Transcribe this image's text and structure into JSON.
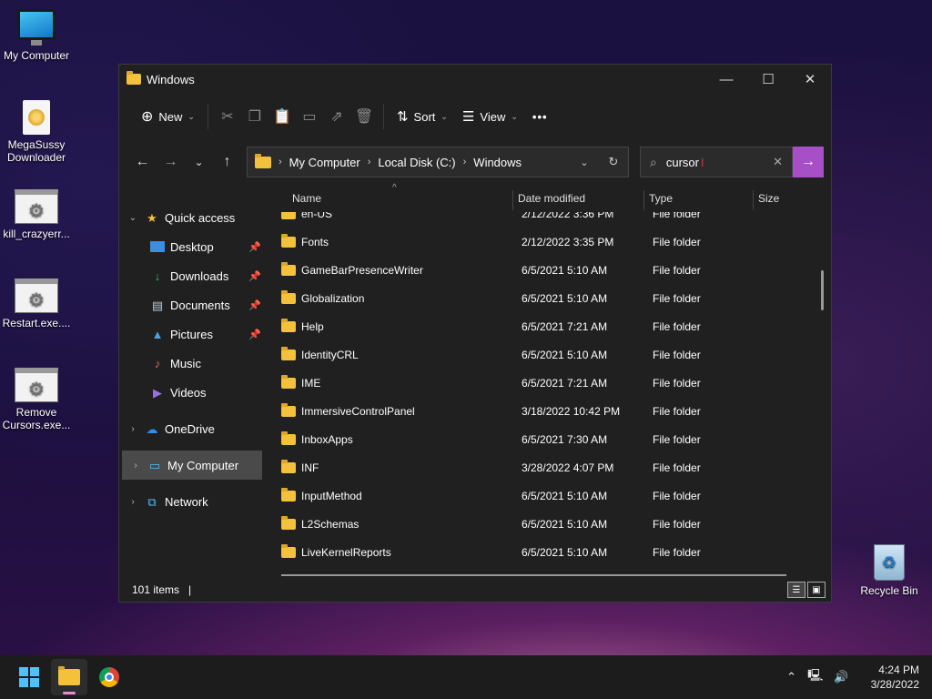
{
  "desktop": {
    "icons": [
      {
        "label": "My Computer"
      },
      {
        "label": "MegaSussy\nDownloader"
      },
      {
        "label": "kill_crazyerr..."
      },
      {
        "label": "Restart.exe...."
      },
      {
        "label": "Remove\nCursors.exe..."
      }
    ],
    "recycle_bin": "Recycle Bin"
  },
  "window": {
    "title": "Windows",
    "toolbar": {
      "new_label": "New",
      "sort_label": "Sort",
      "view_label": "View",
      "more_label": "•••"
    },
    "address": {
      "crumbs": [
        "My Computer",
        "Local Disk (C:)",
        "Windows"
      ]
    },
    "search": {
      "value": "cursor"
    },
    "sidebar": {
      "quick_access": "Quick access",
      "items": [
        "Desktop",
        "Downloads",
        "Documents",
        "Pictures",
        "Music",
        "Videos"
      ],
      "onedrive": "OneDrive",
      "my_computer": "My Computer",
      "network": "Network"
    },
    "columns": {
      "name": "Name",
      "date": "Date modified",
      "type": "Type",
      "size": "Size"
    },
    "rows": [
      {
        "name": "en-US",
        "date": "2/12/2022 3:36 PM",
        "type": "File folder"
      },
      {
        "name": "Fonts",
        "date": "2/12/2022 3:35 PM",
        "type": "File folder"
      },
      {
        "name": "GameBarPresenceWriter",
        "date": "6/5/2021 5:10 AM",
        "type": "File folder"
      },
      {
        "name": "Globalization",
        "date": "6/5/2021 5:10 AM",
        "type": "File folder"
      },
      {
        "name": "Help",
        "date": "6/5/2021 7:21 AM",
        "type": "File folder"
      },
      {
        "name": "IdentityCRL",
        "date": "6/5/2021 5:10 AM",
        "type": "File folder"
      },
      {
        "name": "IME",
        "date": "6/5/2021 7:21 AM",
        "type": "File folder"
      },
      {
        "name": "ImmersiveControlPanel",
        "date": "3/18/2022 10:42 PM",
        "type": "File folder"
      },
      {
        "name": "InboxApps",
        "date": "6/5/2021 7:30 AM",
        "type": "File folder"
      },
      {
        "name": "INF",
        "date": "3/28/2022 4:07 PM",
        "type": "File folder"
      },
      {
        "name": "InputMethod",
        "date": "6/5/2021 5:10 AM",
        "type": "File folder"
      },
      {
        "name": "L2Schemas",
        "date": "6/5/2021 5:10 AM",
        "type": "File folder"
      },
      {
        "name": "LiveKernelReports",
        "date": "6/5/2021 5:10 AM",
        "type": "File folder"
      }
    ],
    "status": {
      "item_count": "101 items"
    }
  },
  "taskbar": {
    "time": "4:24 PM",
    "date": "3/28/2022"
  },
  "colors": {
    "accent": "#a64fc7",
    "folder": "#f3c13a",
    "window_bg": "#202020"
  }
}
